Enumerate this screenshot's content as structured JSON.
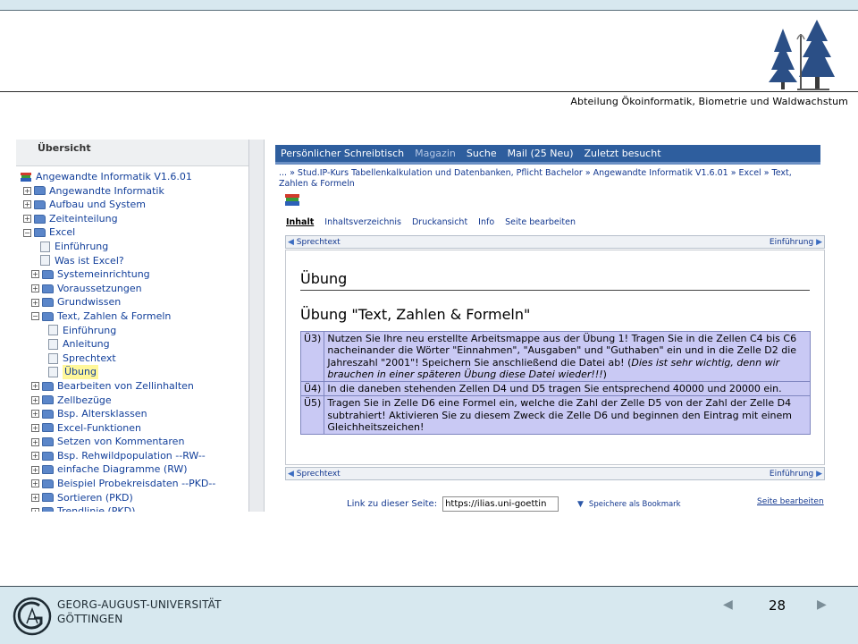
{
  "slide": {
    "department": "Abteilung Ökoinformatik, Biometrie und Waldwachstum",
    "university_line1": "GEORG-AUGUST-UNIVERSITÄT",
    "university_line2": "GÖTTINGEN",
    "page_number": "28",
    "prev_icon": "left-triangle-icon",
    "next_icon": "right-triangle-icon"
  },
  "tree": {
    "title": "Übersicht",
    "items": [
      {
        "label": "Angewandte Informatik V1.6.01",
        "depth": 0,
        "kind": "root"
      },
      {
        "label": "Angewandte Informatik",
        "depth": 0,
        "kind": "folder",
        "toggle": "+"
      },
      {
        "label": "Aufbau und System",
        "depth": 0,
        "kind": "folder",
        "toggle": "+"
      },
      {
        "label": "Zeiteinteilung",
        "depth": 0,
        "kind": "folder",
        "toggle": "+"
      },
      {
        "label": "Excel",
        "depth": 0,
        "kind": "folder",
        "toggle": "−"
      },
      {
        "label": "Einführung",
        "depth": 1,
        "kind": "page"
      },
      {
        "label": "Was ist Excel?",
        "depth": 1,
        "kind": "page"
      },
      {
        "label": "Systemeinrichtung",
        "depth": 1,
        "kind": "folder",
        "toggle": "+"
      },
      {
        "label": "Voraussetzungen",
        "depth": 1,
        "kind": "folder",
        "toggle": "+"
      },
      {
        "label": "Grundwissen",
        "depth": 1,
        "kind": "folder",
        "toggle": "+"
      },
      {
        "label": "Text, Zahlen & Formeln",
        "depth": 1,
        "kind": "folder",
        "toggle": "−"
      },
      {
        "label": "Einführung",
        "depth": 2,
        "kind": "page"
      },
      {
        "label": "Anleitung",
        "depth": 2,
        "kind": "page"
      },
      {
        "label": "Sprechtext",
        "depth": 2,
        "kind": "page"
      },
      {
        "label": "Übung",
        "depth": 2,
        "kind": "page",
        "selected": true
      },
      {
        "label": "Bearbeiten von Zellinhalten",
        "depth": 1,
        "kind": "folder",
        "toggle": "+"
      },
      {
        "label": "Zellbezüge",
        "depth": 1,
        "kind": "folder",
        "toggle": "+"
      },
      {
        "label": "Bsp. Altersklassen",
        "depth": 1,
        "kind": "folder",
        "toggle": "+"
      },
      {
        "label": "Excel-Funktionen",
        "depth": 1,
        "kind": "folder",
        "toggle": "+"
      },
      {
        "label": "Setzen von Kommentaren",
        "depth": 1,
        "kind": "folder",
        "toggle": "+"
      },
      {
        "label": "Bsp. Rehwildpopulation --RW--",
        "depth": 1,
        "kind": "folder",
        "toggle": "+"
      },
      {
        "label": "einfache Diagramme (RW)",
        "depth": 1,
        "kind": "folder",
        "toggle": "+"
      },
      {
        "label": "Beispiel Probekreisdaten --PKD--",
        "depth": 1,
        "kind": "folder",
        "toggle": "+"
      },
      {
        "label": "Sortieren (PKD)",
        "depth": 1,
        "kind": "folder",
        "toggle": "+"
      },
      {
        "label": "Trendlinie (PKD)",
        "depth": 1,
        "kind": "folder",
        "toggle": "+"
      }
    ]
  },
  "menubar": {
    "items": [
      {
        "label": "Persönlicher Schreibtisch",
        "active": true
      },
      {
        "label": "Magazin",
        "active": false
      },
      {
        "label": "Suche",
        "active": true
      },
      {
        "label": "Mail (25 Neu)",
        "active": true
      },
      {
        "label": "Zuletzt besucht",
        "active": true
      }
    ]
  },
  "breadcrumb": "... » Stud.IP-Kurs Tabellenkalkulation und Datenbanken, Pflicht Bachelor » Angewandte Informatik V1.6.01 » Excel » Text, Zahlen & Formeln",
  "tabs": [
    {
      "label": "Inhalt",
      "active": true
    },
    {
      "label": "Inhaltsverzeichnis",
      "active": false
    },
    {
      "label": "Druckansicht",
      "active": false
    },
    {
      "label": "Info",
      "active": false
    },
    {
      "label": "Seite bearbeiten",
      "active": false
    }
  ],
  "nav": {
    "prev_label": "Sprechtext",
    "next_label": "Einführung"
  },
  "content": {
    "heading": "Übung",
    "subheading": "Übung \"Text, Zahlen & Formeln\"",
    "exercises": [
      {
        "code": "Ü3)",
        "text": "Nutzen Sie Ihre neu erstellte Arbeitsmappe aus der Übung 1! Tragen Sie in die Zellen C4 bis C6 nacheinander die Wörter \"Einnahmen\", \"Ausgaben\" und \"Guthaben\" ein und in die Zelle D2 die Jahreszahl \"2001\"! Speichern Sie anschließend die Datei ab! (",
        "italic": "Dies ist sehr wichtig, denn wir brauchen in einer späteren Übung diese Datei wieder!!!",
        "tail": ")"
      },
      {
        "code": "Ü4)",
        "text": "In die daneben stehenden Zellen D4 und D5 tragen Sie entsprechend 40000 und 20000 ein.",
        "italic": "",
        "tail": ""
      },
      {
        "code": "Ü5)",
        "text": "Tragen Sie in Zelle D6 eine Formel ein, welche die Zahl der Zelle D5 von der Zahl der Zelle D4 subtrahiert! Aktivieren Sie zu diesem Zweck die Zelle D6 und beginnen den Eintrag mit einem Gleichheitszeichen!",
        "italic": "",
        "tail": ""
      }
    ]
  },
  "link_row": {
    "label": "Link zu dieser Seite:",
    "url": "https://ilias.uni-goettin",
    "bookmark": "Speichere als Bookmark",
    "edit": "Seite bearbeiten"
  }
}
